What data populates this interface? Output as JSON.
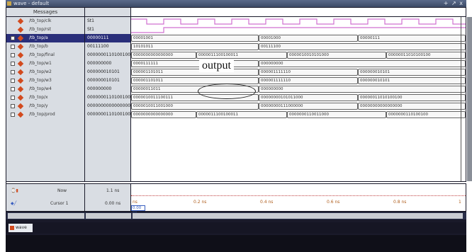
{
  "window": {
    "title": "wave - default",
    "controls": "+ ↗ x"
  },
  "header": {
    "messages_label": "Messages"
  },
  "signals": [
    {
      "name": "/tb_top/clk",
      "value": "St1",
      "has_expander": false
    },
    {
      "name": "/tb_top/rst",
      "value": "St1",
      "has_expander": false
    },
    {
      "name": "/tb_top/a",
      "value": "00000111",
      "has_expander": true,
      "selected": true
    },
    {
      "name": "/tb_top/b",
      "value": "00111100",
      "has_expander": true
    },
    {
      "name": "/tb_top/final",
      "value": "0000000110100100",
      "has_expander": true
    },
    {
      "name": "/tb_top/w1",
      "value": "000000000",
      "has_expander": true
    },
    {
      "name": "/tb_top/w2",
      "value": "000000010101",
      "has_expander": true
    },
    {
      "name": "/tb_top/w3",
      "value": "000000010101",
      "has_expander": true
    },
    {
      "name": "/tb_top/w4",
      "value": "000000000",
      "has_expander": true
    },
    {
      "name": "/tb_top/x",
      "value": "0000000110100100",
      "has_expander": true
    },
    {
      "name": "/tb_top/y",
      "value": "0000000000000000",
      "has_expander": true
    },
    {
      "name": "/tb_top/prod",
      "value": "0000000110100100",
      "has_expander": true
    }
  ],
  "wave_values": {
    "a": [
      "00001001",
      "00001000",
      "00000111"
    ],
    "b": [
      "10101011",
      "00111100"
    ],
    "final": [
      "0000000000000000",
      "0000011100100011",
      "0000010010101000",
      "00000011010100100"
    ],
    "w1": [
      "0000111111",
      "000000000"
    ],
    "w2": [
      "000001101011",
      "000001111110",
      "000000010101"
    ],
    "w3": [
      "000001101011",
      "000001111110",
      "000000010101"
    ],
    "w4": [
      "00000011011",
      "000000000"
    ],
    "x": [
      "0000010011100111",
      "00000000101011000",
      "00000011010100100"
    ],
    "y": [
      "0000010011001000",
      "00000000111000000",
      "00000000000000000"
    ],
    "prod": [
      "0000000000000000",
      "0000011100100011",
      "0000000110011000",
      "0000000110100100"
    ]
  },
  "annotation": {
    "output_label": "output"
  },
  "bottom": {
    "now_label": "Now",
    "now_value": "1.1 ns",
    "cursor_label": "Cursor 1",
    "cursor_value": "0.00 ns",
    "cursor_marker": "0.00 ns",
    "ticks": [
      "ns",
      "0.2 ns",
      "0.4 ns",
      "0.6 ns",
      "0.8 ns",
      "1"
    ]
  },
  "status": {
    "tab_label": "wave"
  },
  "colors": {
    "waveform": "#d070d0",
    "selected_row": "#2a2f7a",
    "signal_icon": "#d24a1e"
  }
}
